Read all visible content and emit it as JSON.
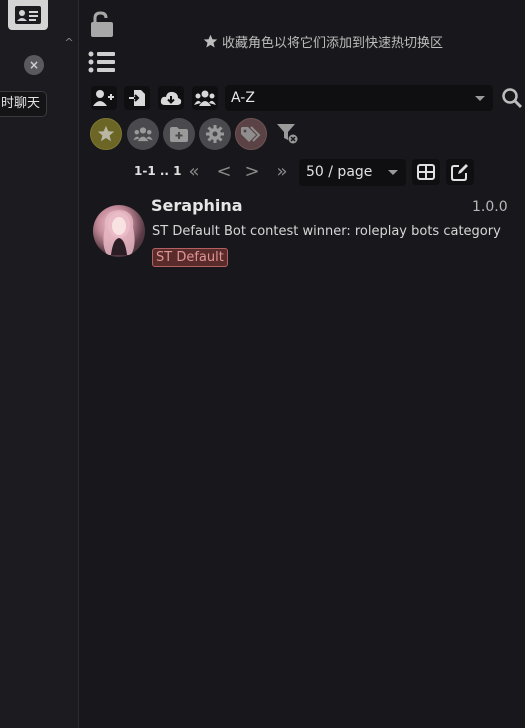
{
  "left_panel": {
    "temp_chat_label": "时聊天",
    "close_symbol": "×",
    "collapse_symbol": "^"
  },
  "header": {
    "favorites_hint": "收藏角色以将它们添加到快速热切换区"
  },
  "toolbar": {
    "sort_value": "A-Z"
  },
  "pagination": {
    "range": "1-1 .. 1",
    "first": "«",
    "prev": "<",
    "next": ">",
    "last": "»",
    "per_page": "50 / page"
  },
  "characters": [
    {
      "name": "Seraphina",
      "version": "1.0.0",
      "description": "ST Default Bot contest winner: roleplay bots category",
      "tag": "ST Default"
    }
  ],
  "colors": {
    "favorite_filter": "#6b6526",
    "tag_background": "#5a2b2b",
    "tag_border": "#b46060"
  },
  "icons": [
    "character-card-icon",
    "lock-open-icon",
    "list-icon",
    "star-icon",
    "add-user-icon",
    "import-icon",
    "cloud-download-icon",
    "group-icon",
    "search-icon",
    "folder-plus-icon",
    "gear-icon",
    "tags-icon",
    "filter-clear-icon",
    "grid-icon",
    "edit-icon"
  ]
}
